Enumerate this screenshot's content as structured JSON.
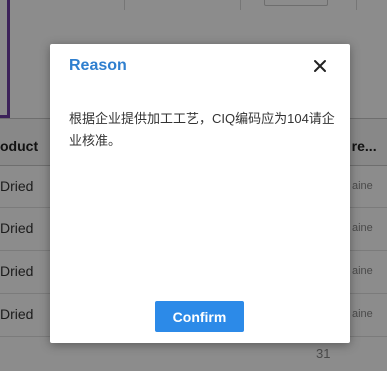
{
  "background": {
    "table": {
      "header_left": "oduct",
      "header_right": "s re...",
      "rows": [
        {
          "left": "Dried",
          "right": "aine"
        },
        {
          "left": "Dried",
          "right": "aine"
        },
        {
          "left": "Dried",
          "right": "aine"
        },
        {
          "left": "Dried",
          "right": "aine"
        }
      ]
    },
    "page_number": "31"
  },
  "dialog": {
    "title": "Reason",
    "close_glyph": "✕",
    "message": "根据企业提供加工工艺，CIQ编码应为104请企业核准。",
    "confirm_label": "Confirm"
  },
  "colors": {
    "title": "#2f7fcf",
    "confirm_bg": "#2c8ae8",
    "sidebar_border": "#6e3fa3"
  }
}
